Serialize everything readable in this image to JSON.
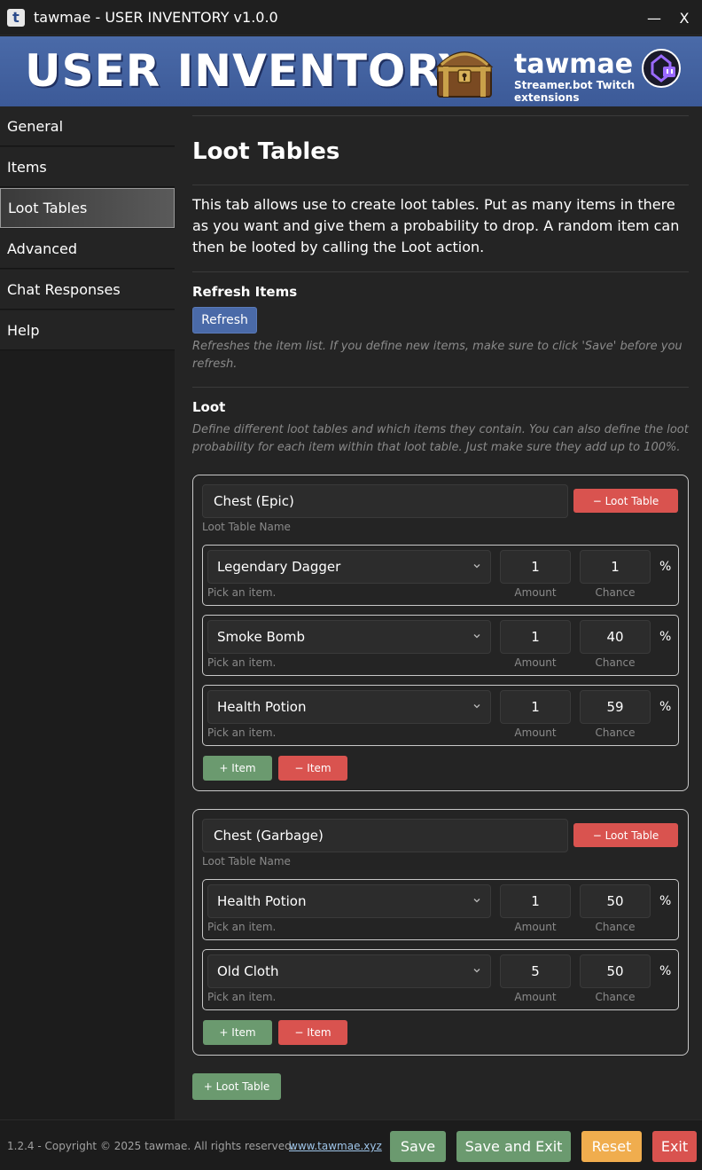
{
  "window": {
    "title": "tawmae - USER INVENTORY v1.0.0",
    "app_icon_letter": "t",
    "minimize": "—",
    "close": "X"
  },
  "banner": {
    "title": "USER INVENTORY",
    "brand": "tawmae",
    "brand_sub": "Streamer.bot Twitch extensions",
    "icon": "treasure-chest-icon"
  },
  "sidebar": {
    "items": [
      {
        "label": "General"
      },
      {
        "label": "Items"
      },
      {
        "label": "Loot Tables",
        "active": true
      },
      {
        "label": "Advanced"
      },
      {
        "label": "Chat Responses"
      },
      {
        "label": "Help"
      }
    ]
  },
  "main": {
    "title": "Loot Tables",
    "intro": "This tab allows use to create loot tables. Put as many items in there as you want and give them a probability to drop. A random item can then be looted by calling the Loot action.",
    "refresh": {
      "heading": "Refresh Items",
      "button": "Refresh",
      "hint": "Refreshes the item list. If you define new items, make sure to click 'Save' before you refresh."
    },
    "loot": {
      "heading": "Loot",
      "hint": "Define different loot tables and which items they contain. You can also define the loot probability for each item within that loot table. Just make sure they add up to 100%."
    },
    "labels": {
      "table_name": "Loot Table Name",
      "pick_item": "Pick an item.",
      "amount": "Amount",
      "chance": "Chance",
      "percent": "%",
      "remove_table": "− Loot Table",
      "add_item": "+ Item",
      "remove_item": "− Item",
      "add_table": "+ Loot Table"
    },
    "tables": [
      {
        "name": "Chest (Epic)",
        "rows": [
          {
            "item": "Legendary Dagger",
            "amount": "1",
            "chance": "1"
          },
          {
            "item": "Smoke Bomb",
            "amount": "1",
            "chance": "40"
          },
          {
            "item": "Health Potion",
            "amount": "1",
            "chance": "59"
          }
        ]
      },
      {
        "name": "Chest (Garbage)",
        "rows": [
          {
            "item": "Health Potion",
            "amount": "1",
            "chance": "50"
          },
          {
            "item": "Old Cloth",
            "amount": "5",
            "chance": "50"
          }
        ]
      }
    ]
  },
  "footer": {
    "copyright": "1.2.4 - Copyright © 2025 tawmae. All rights reserved.",
    "link": "www.tawmae.xyz",
    "save": "Save",
    "save_exit": "Save and Exit",
    "reset": "Reset",
    "exit": "Exit"
  },
  "colors": {
    "accent_blue": "#4a6aa8",
    "green": "#6b9a6f",
    "red": "#d9534f",
    "orange": "#f0ad4e"
  }
}
